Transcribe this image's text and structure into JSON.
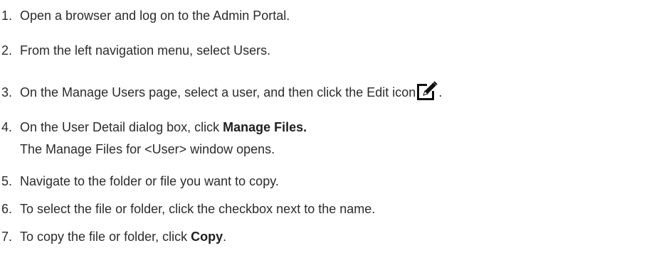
{
  "steps": [
    {
      "number": "1.",
      "text": "Open a browser and log on to the Admin Portal."
    },
    {
      "number": "2.",
      "text": "From the left navigation menu, select Users."
    },
    {
      "number": "3.",
      "text_before": "On the Manage Users page, select a user, and then click the Edit icon",
      "text_after": ".",
      "icon": "edit-icon"
    },
    {
      "number": "4.",
      "text_before": "On the User Detail dialog box, click ",
      "bold": "Manage Files.",
      "subtext": "The Manage Files for <User> window opens."
    },
    {
      "number": "5.",
      "text": "Navigate to the folder or file you want to copy."
    },
    {
      "number": "6.",
      "text": "To select the file or folder, click the checkbox next to the name."
    },
    {
      "number": "7.",
      "text_before": "To copy the file or folder, click ",
      "bold": "Copy",
      "text_after": "."
    }
  ]
}
